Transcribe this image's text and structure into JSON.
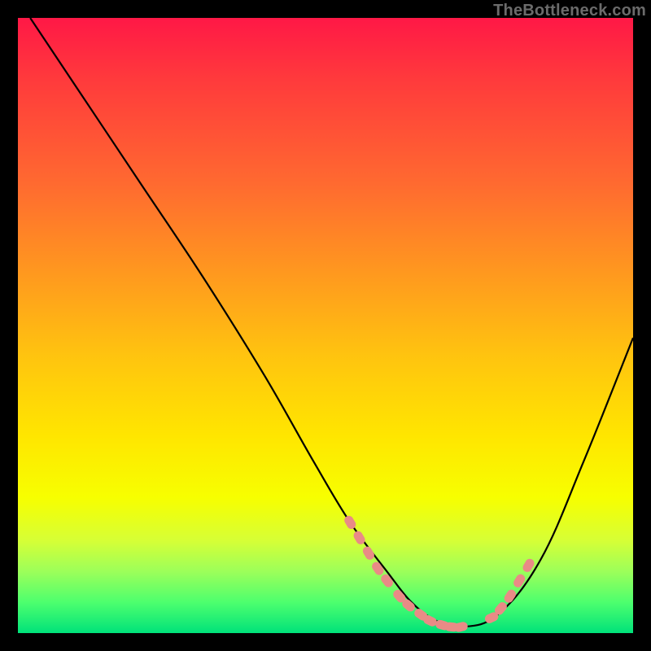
{
  "watermark": "TheBottleneck.com",
  "chart_data": {
    "type": "line",
    "title": "",
    "xlabel": "",
    "ylabel": "",
    "xlim": [
      0,
      100
    ],
    "ylim": [
      0,
      100
    ],
    "grid": false,
    "legend": false,
    "series": [
      {
        "name": "bottleneck-curve",
        "x": [
          2,
          10,
          20,
          30,
          40,
          48,
          54,
          60,
          64,
          68,
          72,
          78,
          85,
          92,
          100
        ],
        "y": [
          100,
          88,
          73,
          58,
          42,
          28,
          18,
          10,
          5,
          2,
          1,
          3,
          12,
          28,
          48
        ]
      }
    ],
    "markers": {
      "name": "highlight-dots",
      "color": "#e98b86",
      "x": [
        54,
        55.5,
        57,
        58.5,
        60,
        62,
        63.5,
        65.5,
        67,
        69,
        70.5,
        72,
        77,
        78.5,
        80,
        81.5,
        83
      ],
      "y": [
        18,
        15.5,
        13,
        10.5,
        8.5,
        6,
        4.5,
        3,
        2,
        1.3,
        1,
        1,
        2.5,
        4,
        6,
        8.5,
        11
      ]
    }
  },
  "colors": {
    "curve": "#000000",
    "marker": "#e98b86",
    "background_top": "#ff1846",
    "background_bottom": "#00e27a"
  }
}
